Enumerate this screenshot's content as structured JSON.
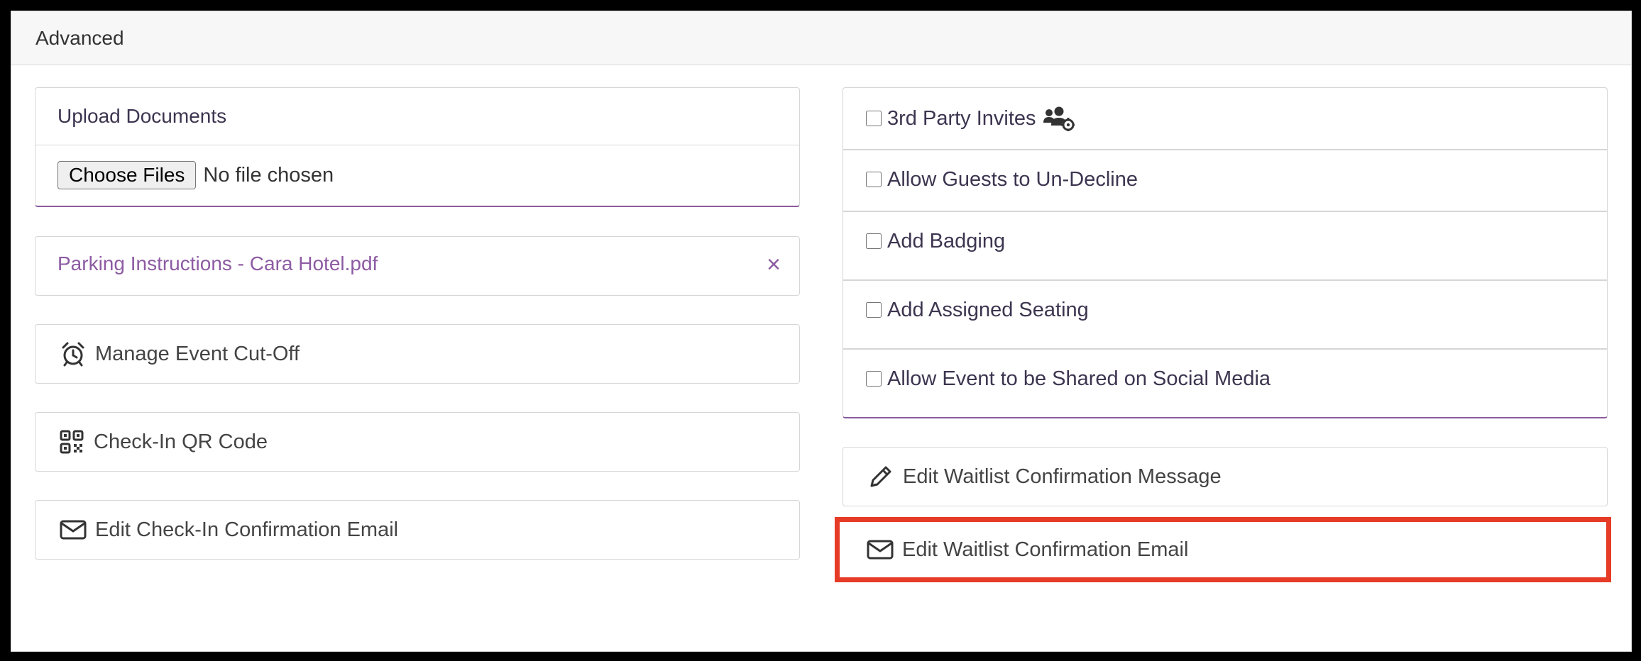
{
  "header": {
    "title": "Advanced"
  },
  "upload": {
    "title": "Upload Documents",
    "button_label": "Choose Files",
    "status": "No file chosen"
  },
  "documents": [
    {
      "name": "Parking Instructions - Cara Hotel.pdf",
      "remove_symbol": "×"
    }
  ],
  "left_actions": [
    {
      "label": "Manage Event Cut-Off",
      "icon": "alarm-clock-icon"
    },
    {
      "label": "Check-In QR Code",
      "icon": "qr-code-icon"
    },
    {
      "label": "Edit Check-In Confirmation Email",
      "icon": "envelope-icon"
    }
  ],
  "options": [
    {
      "label": "3rd Party Invites",
      "checked": false,
      "icon": "users-gear-icon"
    },
    {
      "label": "Allow Guests to Un-Decline",
      "checked": false
    },
    {
      "label": "Add Badging",
      "checked": false
    },
    {
      "label": "Add Assigned Seating",
      "checked": false
    },
    {
      "label": "Allow Event to be Shared on Social Media",
      "checked": false
    }
  ],
  "right_actions": [
    {
      "label": "Edit Waitlist Confirmation Message",
      "icon": "pencil-icon"
    },
    {
      "label": "Edit Waitlist Confirmation Email",
      "icon": "envelope-icon",
      "highlighted": true
    }
  ],
  "colors": {
    "accent": "#8d5ba3",
    "highlight": "#e63b27",
    "text": "#3d3550"
  }
}
